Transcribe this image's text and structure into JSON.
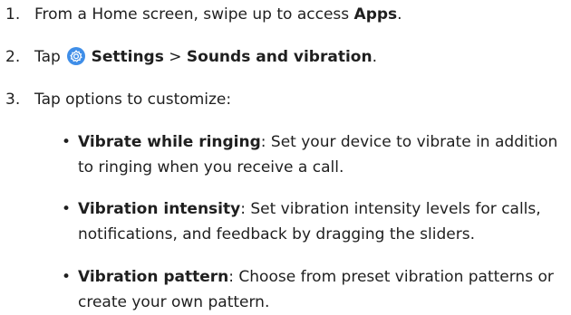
{
  "steps": [
    {
      "number": "1.",
      "text_before": "From a Home screen, swipe up to access ",
      "bold": "Apps",
      "text_after": "."
    },
    {
      "number": "2.",
      "text_before": "Tap ",
      "icon": "settings-icon",
      "bold_1": "Settings",
      "separator": " > ",
      "bold_2": "Sounds and vibration",
      "text_after": "."
    },
    {
      "number": "3.",
      "text": "Tap options to customize:"
    }
  ],
  "bullets": [
    {
      "bullet": "•",
      "title": "Vibrate while ringing",
      "description": ": Set your device to vibrate in addition to ringing when you receive a call."
    },
    {
      "bullet": "•",
      "title": "Vibration intensity",
      "description": ": Set vibration intensity levels for calls, notifications, and feedback by dragging the sliders."
    },
    {
      "bullet": "•",
      "title": "Vibration pattern",
      "description": ": Choose from preset vibration patterns or create your own pattern."
    }
  ],
  "colors": {
    "text": "#1f1f1f",
    "settings_icon_bg": "#3f8ee8",
    "settings_icon_fg": "#ffffff"
  }
}
